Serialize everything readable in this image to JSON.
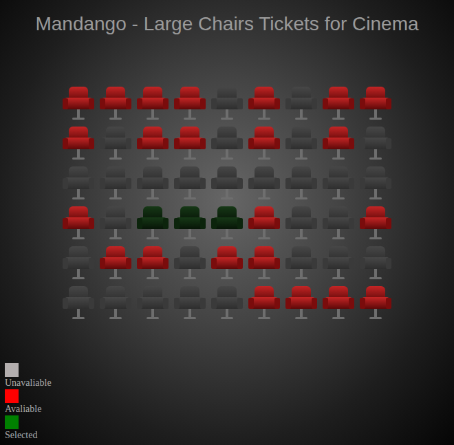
{
  "title": "Mandango - Large Chairs Tickets for Cinema",
  "rows": [
    {
      "seats": [
        {
          "available": true,
          "selected": false
        },
        {
          "available": true,
          "selected": false
        },
        {
          "available": true,
          "selected": false
        },
        {
          "available": true,
          "selected": false
        },
        {
          "available": false,
          "selected": false
        },
        {
          "available": true,
          "selected": false
        },
        {
          "available": false,
          "selected": false
        },
        {
          "available": true,
          "selected": false
        },
        {
          "available": true,
          "selected": false
        }
      ]
    },
    {
      "seats": [
        {
          "available": true,
          "selected": false
        },
        {
          "available": false,
          "selected": false
        },
        {
          "available": true,
          "selected": false
        },
        {
          "available": true,
          "selected": false
        },
        {
          "available": false,
          "selected": false
        },
        {
          "available": true,
          "selected": false
        },
        {
          "available": false,
          "selected": false
        },
        {
          "available": true,
          "selected": false
        },
        {
          "available": false,
          "selected": false
        }
      ]
    },
    {
      "seats": [
        {
          "available": false,
          "selected": false
        },
        {
          "available": false,
          "selected": false
        },
        {
          "available": false,
          "selected": false
        },
        {
          "available": false,
          "selected": false
        },
        {
          "available": false,
          "selected": false
        },
        {
          "available": false,
          "selected": false
        },
        {
          "available": false,
          "selected": false
        },
        {
          "available": false,
          "selected": false
        },
        {
          "available": false,
          "selected": false
        }
      ]
    },
    {
      "seats": [
        {
          "available": true,
          "selected": false
        },
        {
          "available": false,
          "selected": false
        },
        {
          "available": true,
          "selected": true
        },
        {
          "available": true,
          "selected": true
        },
        {
          "available": true,
          "selected": true
        },
        {
          "available": true,
          "selected": false
        },
        {
          "available": false,
          "selected": false
        },
        {
          "available": false,
          "selected": false
        },
        {
          "available": true,
          "selected": false
        }
      ]
    },
    {
      "seats": [
        {
          "available": false,
          "selected": false
        },
        {
          "available": true,
          "selected": false
        },
        {
          "available": true,
          "selected": false
        },
        {
          "available": false,
          "selected": false
        },
        {
          "available": true,
          "selected": false
        },
        {
          "available": true,
          "selected": false
        },
        {
          "available": false,
          "selected": false
        },
        {
          "available": false,
          "selected": false
        },
        {
          "available": false,
          "selected": false
        }
      ]
    },
    {
      "seats": [
        {
          "available": false,
          "selected": false
        },
        {
          "available": false,
          "selected": false
        },
        {
          "available": false,
          "selected": false
        },
        {
          "available": false,
          "selected": false
        },
        {
          "available": false,
          "selected": false
        },
        {
          "available": true,
          "selected": false
        },
        {
          "available": true,
          "selected": false
        },
        {
          "available": true,
          "selected": false
        },
        {
          "available": true,
          "selected": false
        }
      ]
    }
  ],
  "legend": [
    {
      "label": "Unavaliable",
      "color": "#b3aeae"
    },
    {
      "label": "Avaliable",
      "color": "#ff0000"
    },
    {
      "label": "Selected",
      "color": "#008000"
    }
  ]
}
